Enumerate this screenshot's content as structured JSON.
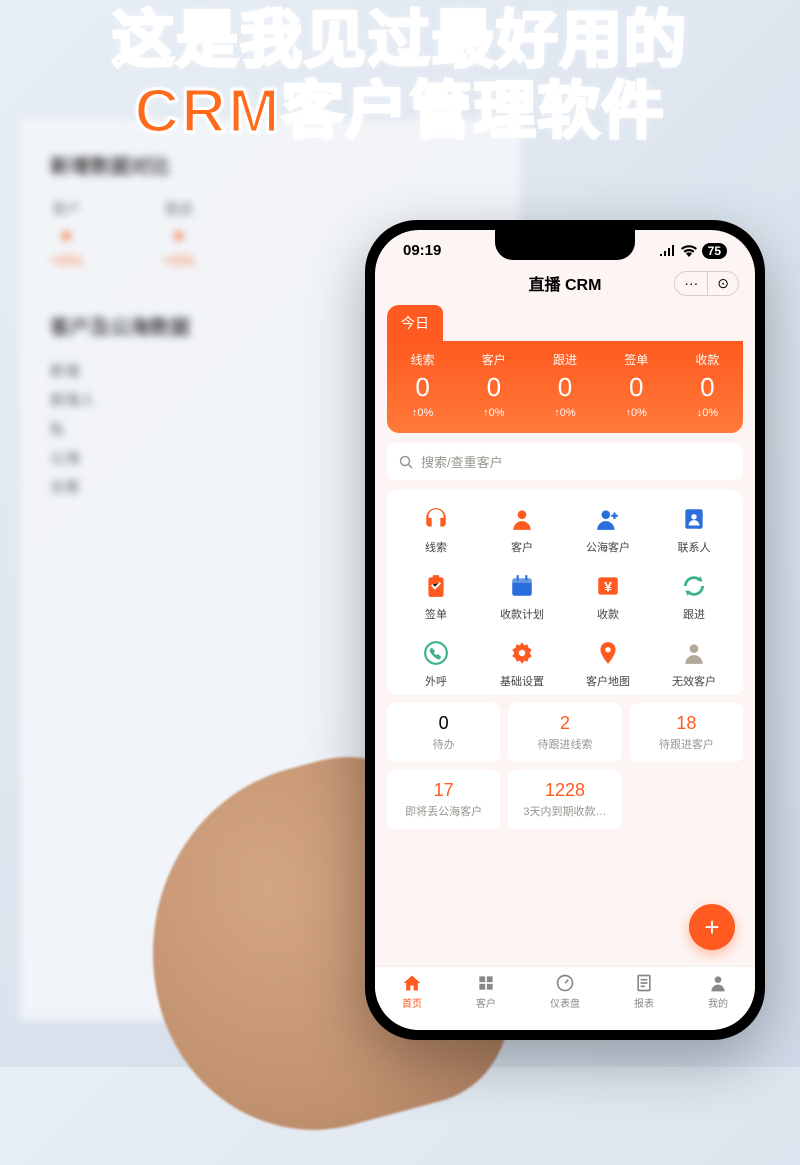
{
  "headline": "这是我见过最好用的\nCRM客户管理软件",
  "bg": {
    "section1_title": "新增数据对比",
    "col1_label": "客户",
    "col2_label": "跟进",
    "delta": "+0%",
    "section2_title": "客户及公海数据",
    "rows": [
      "新增",
      "新增人",
      "私",
      "公海",
      "合客"
    ]
  },
  "status": {
    "time": "09:19",
    "battery": "75"
  },
  "header": {
    "title": "直播 CRM",
    "more": "···",
    "target": "⊙"
  },
  "dash": {
    "tab": "今日",
    "cols": [
      {
        "label": "线索",
        "value": "0",
        "delta": "↑0%"
      },
      {
        "label": "客户",
        "value": "0",
        "delta": "↑0%"
      },
      {
        "label": "跟进",
        "value": "0",
        "delta": "↑0%"
      },
      {
        "label": "签单",
        "value": "0",
        "delta": "↑0%"
      },
      {
        "label": "收款",
        "value": "0",
        "delta": "↓0%"
      }
    ]
  },
  "search": {
    "placeholder": "搜索/查重客户"
  },
  "grid": [
    {
      "label": "线索",
      "icon": "headset",
      "color": "#ff5a1f"
    },
    {
      "label": "客户",
      "icon": "person",
      "color": "#ff5a1f"
    },
    {
      "label": "公海客户",
      "icon": "person-plus",
      "color": "#2a6fdb"
    },
    {
      "label": "联系人",
      "icon": "contact",
      "color": "#2a6fdb"
    },
    {
      "label": "签单",
      "icon": "clipboard",
      "color": "#ff5a1f"
    },
    {
      "label": "收款计划",
      "icon": "calendar",
      "color": "#2a6fdb"
    },
    {
      "label": "收款",
      "icon": "money",
      "color": "#ff5a1f"
    },
    {
      "label": "跟进",
      "icon": "refresh",
      "color": "#3bb08f"
    },
    {
      "label": "外呼",
      "icon": "call",
      "color": "#3bb08f"
    },
    {
      "label": "基础设置",
      "icon": "gear",
      "color": "#ff5a1f"
    },
    {
      "label": "客户地图",
      "icon": "location",
      "color": "#ff5a1f"
    },
    {
      "label": "无效客户",
      "icon": "person-x",
      "color": "#b4a89a"
    }
  ],
  "kpis": [
    {
      "value": "0",
      "label": "待办",
      "highlight": false
    },
    {
      "value": "2",
      "label": "待跟进线索",
      "highlight": true
    },
    {
      "value": "18",
      "label": "待跟进客户",
      "highlight": true
    },
    {
      "value": "17",
      "label": "即将丢公海客户",
      "highlight": true
    },
    {
      "value": "1228",
      "label": "3天内到期收款…",
      "highlight": true
    }
  ],
  "fab": "+",
  "tabs": [
    {
      "label": "首页",
      "icon": "home",
      "active": true
    },
    {
      "label": "客户",
      "icon": "people",
      "active": false
    },
    {
      "label": "仪表盘",
      "icon": "dashboard",
      "active": false
    },
    {
      "label": "报表",
      "icon": "report",
      "active": false
    },
    {
      "label": "我的",
      "icon": "user",
      "active": false
    }
  ]
}
